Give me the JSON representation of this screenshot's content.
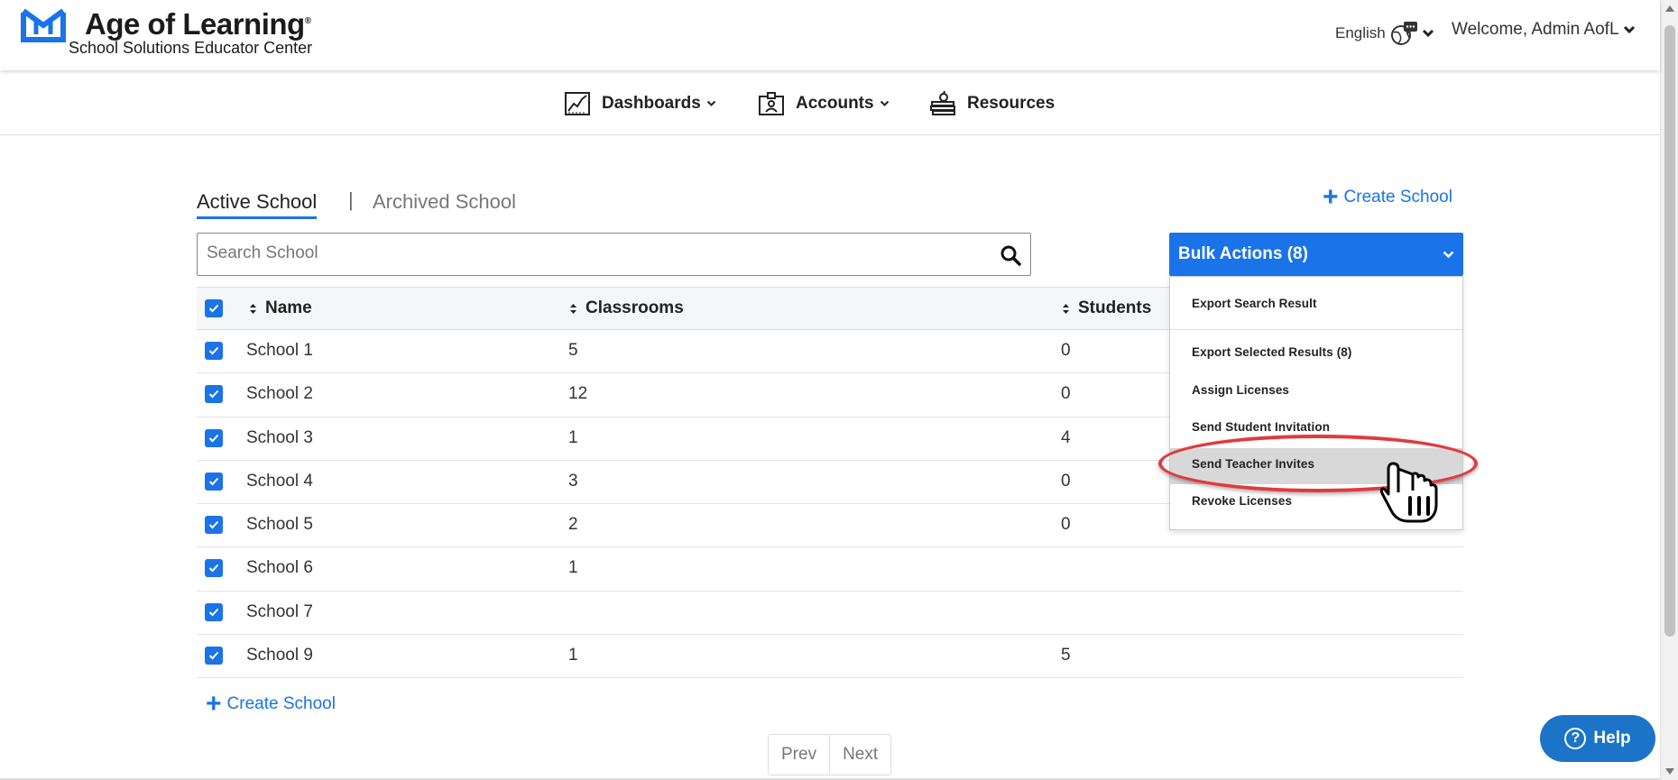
{
  "header": {
    "brand_title": "Age of Learning",
    "brand_reg": "®",
    "brand_subtitle": "School Solutions Educator Center",
    "language": "English",
    "welcome": "Welcome, Admin AofL"
  },
  "nav": {
    "items": [
      {
        "label": "Dashboards",
        "icon": "chart-icon",
        "has_dropdown": true
      },
      {
        "label": "Accounts",
        "icon": "id-badge-icon",
        "has_dropdown": true
      },
      {
        "label": "Resources",
        "icon": "books-apple-icon",
        "has_dropdown": false
      }
    ]
  },
  "tabs": {
    "active": "Active School",
    "separator": "|",
    "archived": "Archived School"
  },
  "create_school_label": "Create School",
  "search": {
    "placeholder": "Search School",
    "value": ""
  },
  "bulk_actions": {
    "label": "Bulk Actions (8)",
    "items": [
      "Export Search Result",
      "Export Selected Results (8)",
      "Assign Licenses",
      "Send Student Invitation",
      "Send Teacher Invites",
      "Revoke Licenses"
    ],
    "highlighted": "Send Teacher Invites"
  },
  "table": {
    "columns": [
      "Name",
      "Classrooms",
      "Students"
    ],
    "rows": [
      {
        "name": "School 1",
        "classrooms": "5",
        "students": "0",
        "checked": true
      },
      {
        "name": "School 2",
        "classrooms": "12",
        "students": "0",
        "checked": true
      },
      {
        "name": "School 3",
        "classrooms": "1",
        "students": "4",
        "checked": true
      },
      {
        "name": "School 4",
        "classrooms": "3",
        "students": "0",
        "checked": true
      },
      {
        "name": "School 5",
        "classrooms": "2",
        "students": "0",
        "checked": true
      },
      {
        "name": "School 6",
        "classrooms": "1",
        "students": "",
        "checked": true
      },
      {
        "name": "School 7",
        "classrooms": "",
        "students": "",
        "checked": true
      },
      {
        "name": "School 9",
        "classrooms": "1",
        "students": "5",
        "checked": true
      }
    ]
  },
  "pagination": {
    "prev": "Prev",
    "next": "Next"
  },
  "help": {
    "label": "Help",
    "icon": "?"
  },
  "colors": {
    "accent": "#1a73e8",
    "callout": "#e03a3e",
    "help": "#1c74c9"
  }
}
